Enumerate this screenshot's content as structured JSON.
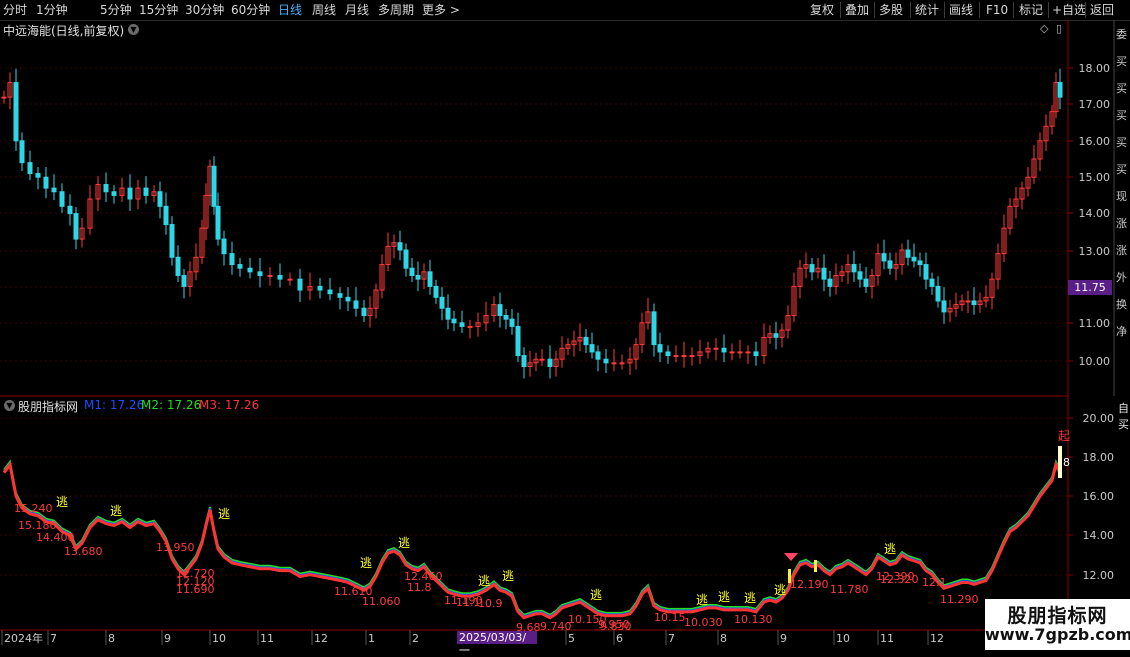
{
  "toolbar": {
    "left": [
      "分时",
      "1分钟",
      "5分钟",
      "15分钟",
      "30分钟",
      "60分钟",
      "日线",
      "周线",
      "月线",
      "多周期",
      "更多 >"
    ],
    "active": "日线",
    "right": [
      "复权",
      "叠加",
      "多股",
      "统计",
      "画线",
      "F10",
      "标记",
      "+自选",
      "返回"
    ]
  },
  "kline_panel": {
    "title": "中远海能(日线,前复权)",
    "price_ticks": [
      "18.00",
      "17.00",
      "16.00",
      "15.00",
      "14.00",
      "13.00",
      "12.00",
      "11.00",
      "10.00"
    ],
    "current_price_tag": "11.75",
    "sidebar_chars": [
      "委",
      "买",
      "买",
      "买",
      "买",
      "买",
      "现",
      "涨",
      "涨",
      "外",
      "换",
      "净"
    ]
  },
  "indicator_panel": {
    "title": "股朋指标网",
    "m1": "M1: 17.26",
    "m2": "M2: 17.26",
    "m3": "M3: 17.26",
    "m_colors": {
      "m1": "#1a4dff",
      "m2": "#22dd22",
      "m3": "#ff3333"
    },
    "ticks": [
      "20.00",
      "18.00",
      "16.00",
      "14.00",
      "12.00"
    ],
    "flag_labels": [
      "逃",
      "逃",
      "逃",
      "逃",
      "逃",
      "逃",
      "逃",
      "逃",
      "逃",
      "逃",
      "逃",
      "逃",
      "逃"
    ],
    "start_label": "起",
    "side_label": "8",
    "side_chars": [
      "自",
      "买"
    ],
    "price_labels": [
      "15.240",
      "15.180",
      "14.400",
      "13.680",
      "13.950",
      "12.720",
      "12.120",
      "11.690",
      "11.610",
      "11.060",
      "12.460",
      "11.8",
      "11.190",
      "11.1",
      "10.9",
      "9.68",
      "9.740",
      "10.150",
      "9.950",
      "9.830",
      "10.15",
      "10.030",
      "10.130",
      "12.190",
      "11.780",
      "12.390",
      "12.320",
      "12.1",
      "11.290"
    ]
  },
  "time_axis": {
    "labels": [
      "2024年",
      "7",
      "8",
      "9",
      "10",
      "11",
      "12",
      "1",
      "2",
      "5",
      "6",
      "7",
      "8",
      "9",
      "10",
      "11",
      "12"
    ],
    "crosshair_date": "2025/03/03/一"
  },
  "watermark": {
    "title": "股朋指标网",
    "url": "www.7gpzb.com"
  }
}
